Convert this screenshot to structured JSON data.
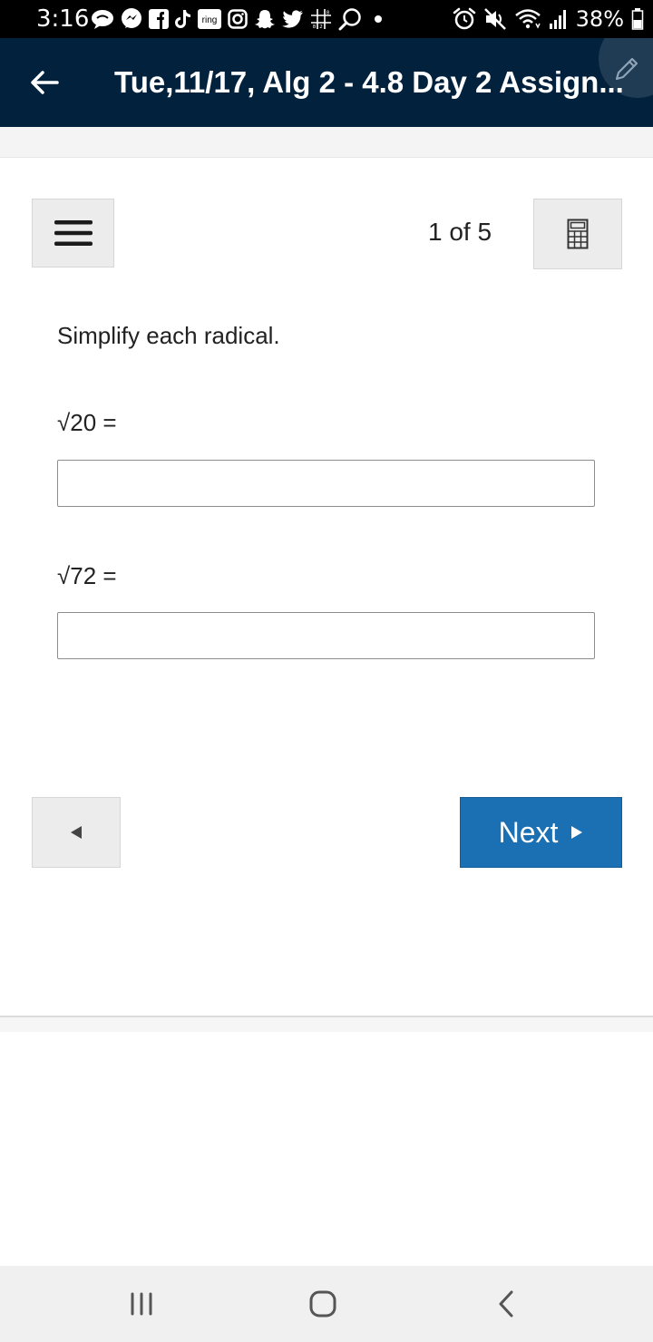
{
  "status_bar": {
    "time": "3:16",
    "battery": "38%",
    "notification_icons": [
      "chat-bubble-icon",
      "messenger-icon",
      "facebook-icon",
      "tiktok-icon",
      "ring-icon",
      "instagram-icon",
      "snapchat-icon",
      "twitter-icon",
      "tic-tac-toe-icon",
      "search-icon",
      "dot-icon"
    ],
    "ring_label": "ring",
    "system_icons": [
      "alarm-icon",
      "mute-icon",
      "wifi-icon",
      "signal-icon",
      "battery-icon"
    ]
  },
  "header": {
    "title": "Tue,11/17, Alg 2 - 4.8 Day 2 Assign..."
  },
  "toolbar": {
    "page_counter": "1 of 5"
  },
  "question": {
    "instructions": "Simplify each radical.",
    "items": [
      {
        "label": "√20 =",
        "value": ""
      },
      {
        "label": "√72 =",
        "value": ""
      }
    ]
  },
  "navigation": {
    "next_label": "Next"
  },
  "colors": {
    "header_bg": "#02213d",
    "next_button_bg": "#1a70b3",
    "status_bar_bg": "#000000"
  }
}
